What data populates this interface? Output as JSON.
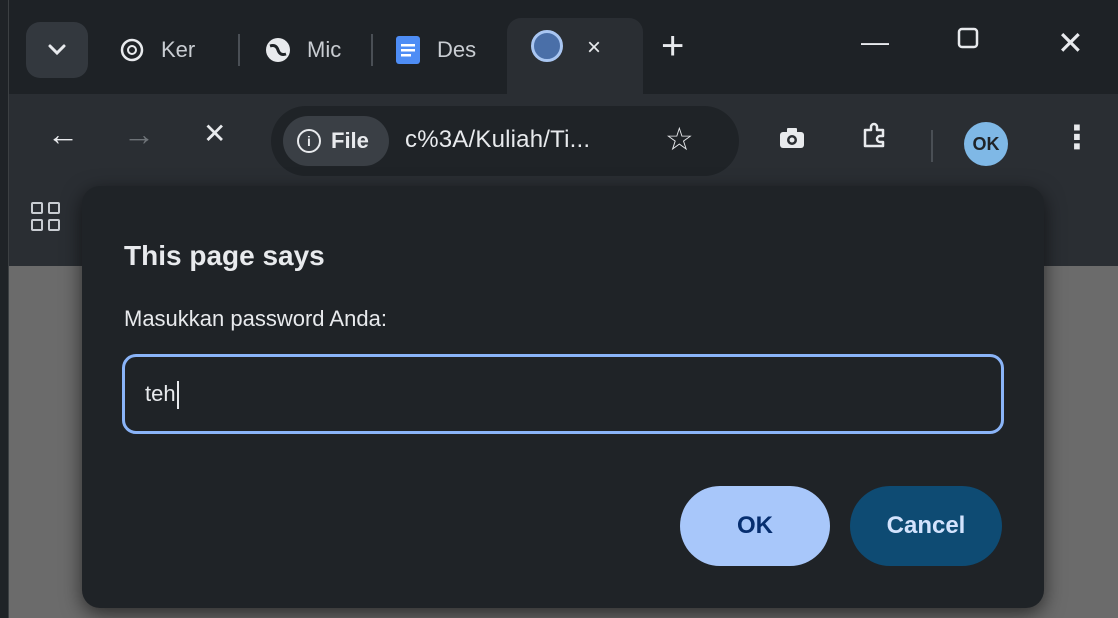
{
  "tabs": [
    {
      "title": "Ker",
      "icon": "openai-icon"
    },
    {
      "title": "Mic",
      "icon": "globe-icon"
    },
    {
      "title": "Des",
      "icon": "docs-icon"
    }
  ],
  "active_tab": {
    "icon": "site-logo-icon",
    "close": "×"
  },
  "toolbar": {
    "chip_label": "File",
    "url": "c%3A/Kuliah/Ti..."
  },
  "dialog": {
    "title": "This page says",
    "message": "Masukkan password Anda:",
    "input_value": "teh",
    "ok_label": "OK",
    "cancel_label": "Cancel"
  },
  "avatar_text": "OK",
  "colors": {
    "accent": "#a8c7fa",
    "cancel_bg": "#0e4b73",
    "dialog_bg": "#1f2327"
  }
}
